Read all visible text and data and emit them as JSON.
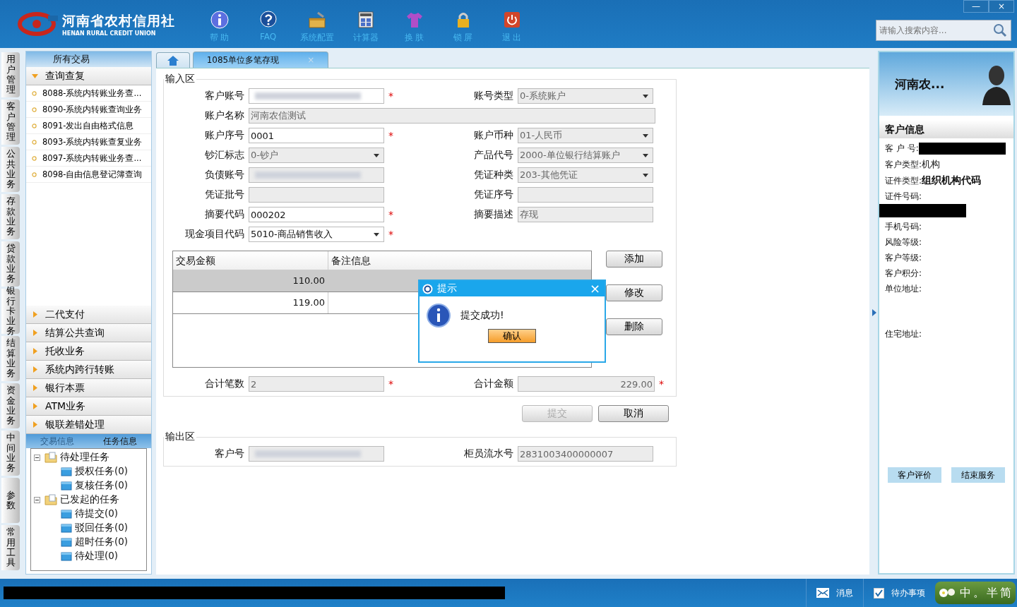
{
  "header": {
    "logo_cn": "河南省农村信用社",
    "logo_en": "HENAN RURAL CREDIT UNION",
    "toolbar": [
      {
        "label": "帮 助",
        "kind": "info"
      },
      {
        "label": "FAQ",
        "kind": "help"
      },
      {
        "label": "系统配置",
        "kind": "toolbox"
      },
      {
        "label": "计算器",
        "kind": "calculator"
      },
      {
        "label": "换 肤",
        "kind": "shirt"
      },
      {
        "label": "锁 屏",
        "kind": "lock"
      },
      {
        "label": "退 出",
        "kind": "power"
      }
    ],
    "search": {
      "placeholder": "请输入搜索内容..."
    },
    "window_controls": [
      "—",
      "×"
    ]
  },
  "left_tabs": [
    "用户管理",
    "客户管理",
    "公共业务",
    "存款业务",
    "贷款业务",
    "银行卡业务",
    "结算业务",
    "资金业务",
    "中间业务",
    "参数",
    "常用工具"
  ],
  "sidebar": {
    "title": "所有交易",
    "groups": [
      {
        "label": "查询查复",
        "expanded": true,
        "items": [
          "8088-系统内转账业务查...",
          "8090-系统内转账查询业务",
          "8091-发出自由格式信息",
          "8093-系统内转账查复业务",
          "8097-系统内转账业务查...",
          "8098-自由信息登记簿查询"
        ]
      },
      {
        "label": "二代支付",
        "expanded": false
      },
      {
        "label": "结算公共查询",
        "expanded": false
      },
      {
        "label": "托收业务",
        "expanded": false
      },
      {
        "label": "系统内跨行转账",
        "expanded": false
      },
      {
        "label": "银行本票",
        "expanded": false
      },
      {
        "label": "ATM业务",
        "expanded": false
      },
      {
        "label": "银联差错处理",
        "expanded": false
      }
    ],
    "panel_tabs": [
      {
        "label": "交易信息",
        "selected": false
      },
      {
        "label": "任务信息",
        "selected": true
      }
    ],
    "tree": [
      {
        "label": "待处理任务",
        "expanded": true,
        "children": [
          {
            "label": "授权任务(0)"
          },
          {
            "label": "复核任务(0)"
          }
        ]
      },
      {
        "label": "已发起的任务",
        "expanded": true,
        "children": [
          {
            "label": "待提交(0)"
          },
          {
            "label": "驳回任务(0)"
          },
          {
            "label": "超时任务(0)"
          },
          {
            "label": "待处理(0)"
          }
        ]
      }
    ]
  },
  "main": {
    "tabs": [
      {
        "kind": "home",
        "selected": false
      },
      {
        "kind": "page",
        "label": "1085单位多笔存现",
        "selected": true,
        "close": "×"
      }
    ],
    "input_section": {
      "legend": "输入区",
      "rows": [
        [
          {
            "label": "客户账号",
            "kind": "input",
            "masked": true,
            "readonly": false,
            "required_mark": "*"
          },
          {
            "label": "账号类型",
            "kind": "select",
            "value": "0-系统账户",
            "readonly": true
          }
        ],
        [
          {
            "label": "账户名称",
            "kind": "input",
            "value": "河南农信测试",
            "readonly": true,
            "wide": true
          }
        ],
        [
          {
            "label": "账户序号",
            "kind": "input",
            "value": "0001",
            "readonly": false,
            "required_mark": "*"
          },
          {
            "label": "账户币种",
            "kind": "select",
            "value": "01-人民币",
            "readonly": true
          }
        ],
        [
          {
            "label": "钞汇标志",
            "kind": "select",
            "value": "0-钞户",
            "readonly": true
          },
          {
            "label": "产品代号",
            "kind": "select",
            "value": "2000-单位银行结算账户",
            "readonly": true
          }
        ],
        [
          {
            "label": "负债账号",
            "kind": "input",
            "masked": true,
            "readonly": true
          },
          {
            "label": "凭证种类",
            "kind": "select",
            "value": "203-其他凭证",
            "readonly": true
          }
        ],
        [
          {
            "label": "凭证批号",
            "kind": "input",
            "readonly": true
          },
          {
            "label": "凭证序号",
            "kind": "input",
            "readonly": true
          }
        ],
        [
          {
            "label": "摘要代码",
            "kind": "input",
            "value": "000202",
            "readonly": false,
            "required_mark": "*"
          },
          {
            "label": "摘要描述",
            "kind": "input",
            "value": "存现",
            "readonly": true
          }
        ],
        [
          {
            "label": "现金项目代码",
            "kind": "select",
            "value": "5010-商品销售收入",
            "readonly": false,
            "required_mark": "*"
          }
        ]
      ],
      "table": {
        "columns": [
          "交易金额",
          "备注信息"
        ],
        "rows": [
          {
            "amount": "110.00",
            "selected": true
          },
          {
            "amount": "119.00",
            "selected": false
          }
        ]
      },
      "side_buttons": [
        "添加",
        "修改",
        "删除"
      ],
      "totals": [
        {
          "label": "合计笔数",
          "value": "2",
          "kind": "count",
          "required_mark": "*"
        },
        {
          "label": "合计金额",
          "value": "229.00",
          "kind": "amount",
          "required_mark": "*"
        }
      ]
    },
    "actions": [
      {
        "label": "提交",
        "disabled": true
      },
      {
        "label": "取消",
        "disabled": false
      }
    ],
    "output_section": {
      "legend": "输出区",
      "fields": [
        {
          "label": "客户号",
          "masked": true
        },
        {
          "label": "柜员流水号",
          "value": "2831003400000007"
        }
      ]
    },
    "dialog": {
      "title": "提示",
      "message": "提交成功!",
      "button": "确认",
      "close": "×"
    }
  },
  "customer_panel": {
    "name": "河南农...",
    "section": "客户信息",
    "info": [
      {
        "label": "客 户 号:",
        "redacted": true
      },
      {
        "label": "客户类型:",
        "value": "机构"
      },
      {
        "label": "证件类型:",
        "value": "组织机构代码"
      },
      {
        "label": "证件号码:",
        "redacted": true
      },
      {
        "label": "手机号码:"
      },
      {
        "label": "风险等级:"
      },
      {
        "label": "客户等级:"
      },
      {
        "label": "客户积分:"
      },
      {
        "label": "单位地址:"
      },
      {
        "label": "住宅地址:"
      }
    ],
    "buttons": [
      "客户评价",
      "结束服务"
    ]
  },
  "status_bar": {
    "redacted": true,
    "items": [
      {
        "label": "消息",
        "kind": "mail"
      },
      {
        "label": "待办事项",
        "kind": "check"
      }
    ],
    "ime": [
      "中",
      "。",
      "半",
      "简"
    ]
  }
}
